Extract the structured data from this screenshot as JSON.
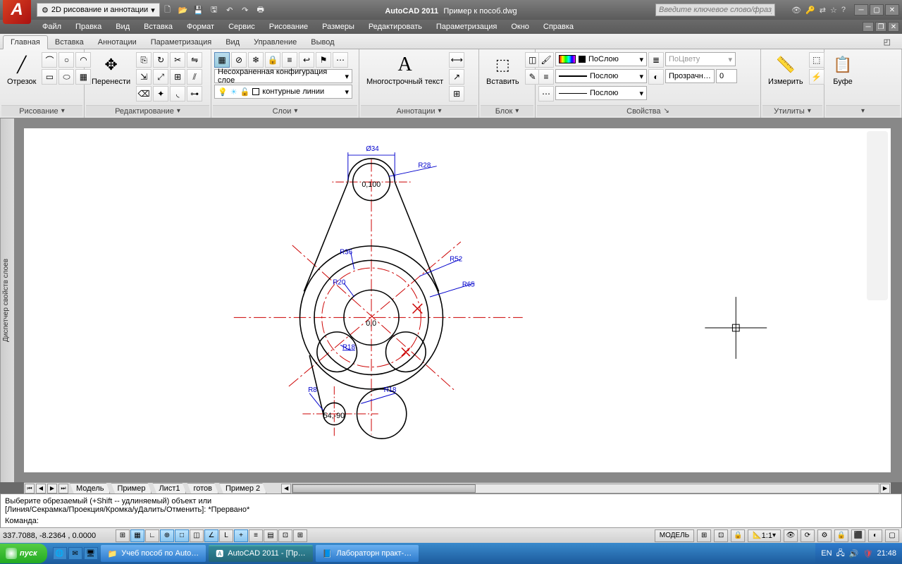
{
  "title": {
    "app": "AutoCAD 2011",
    "file": "Пример к пособ.dwg"
  },
  "workspace_dd": "2D рисование и аннотации",
  "search_placeholder": "Введите ключевое слово/фразу",
  "menus": [
    "Файл",
    "Правка",
    "Вид",
    "Вставка",
    "Формат",
    "Сервис",
    "Рисование",
    "Размеры",
    "Редактировать",
    "Параметризация",
    "Окно",
    "Справка"
  ],
  "ribbon_tabs": [
    "Главная",
    "Вставка",
    "Аннотации",
    "Параметризация",
    "Вид",
    "Управление",
    "Вывод"
  ],
  "panels": {
    "draw": "Рисование",
    "draw_big": "Отрезок",
    "modify": "Редактирование",
    "modify_big": "Перенести",
    "layers": "Слои",
    "layer_config": "Несохраненная конфигурация слое",
    "layer_current": "контурные линии",
    "annot": "Аннотации",
    "annot_big": "Многострочный текст",
    "block": "Блок",
    "block_big": "Вставить",
    "props": "Свойства",
    "prop_color": "ПоСлою",
    "prop_line": "Послою",
    "prop_lw": "Послою",
    "prop_bycolor": "ПоЦвету",
    "prop_trans": "Прозрачн…",
    "prop_trans_val": "0",
    "utils": "Утилиты",
    "utils_big": "Измерить",
    "clip": "Буфе"
  },
  "side_palette": "Диспетчер свойств слоев",
  "layout_tabs": [
    "Модель",
    "Пример",
    "Лист1",
    "готов",
    "Пример 2"
  ],
  "cmd": {
    "line1": "Выберите обрезаемый (+Shift -- удлиняемый) объект или",
    "line2": "[Линия/Секрамка/Проекция/Кромка/уДалить/Отменить]: *Прервано*",
    "prompt": "Команда:"
  },
  "coords": "337.7088, -8.2364 , 0.0000",
  "status_right": {
    "model": "МОДЕЛЬ",
    "scale": "1:1"
  },
  "taskbar": {
    "start": "пуск",
    "items": [
      "Учеб пособ по Auto…",
      "AutoCAD 2011 - [Пр…",
      "Лабораторн практ-…"
    ],
    "lang": "EN",
    "time": "21:48"
  },
  "drawing": {
    "dims": {
      "d34": "Ø34",
      "r28": "R28",
      "r52": "R52",
      "r65": "R65",
      "r36": "R36",
      "r20": "R20",
      "r18a": "R18",
      "r18b": "R18",
      "r8": "R8"
    },
    "pts": {
      "top": "0,100",
      "center": "0,0",
      "bottom": "54,-90"
    }
  }
}
